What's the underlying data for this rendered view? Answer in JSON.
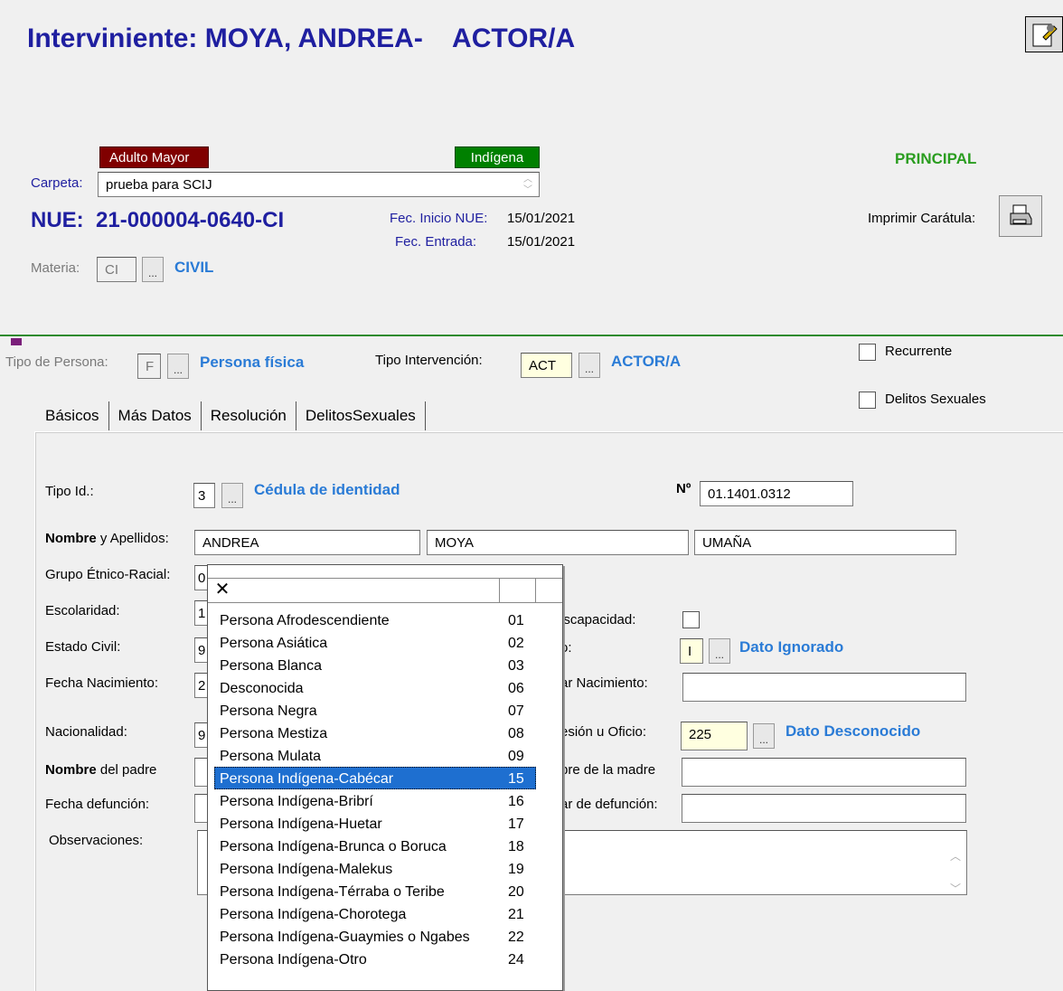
{
  "title": "Interviniente: MOYA, ANDREA-    ACTOR/A",
  "badges": {
    "adulto": "Adulto Mayor",
    "indigena": "Indígena"
  },
  "principal": "PRINCIPAL",
  "carpeta": {
    "label": "Carpeta:",
    "value": "prueba para SCIJ"
  },
  "nue": {
    "label": "NUE:",
    "value": "21-000004-0640-CI"
  },
  "fechas": {
    "inicio_label": "Fec. Inicio NUE:",
    "inicio": "15/01/2021",
    "entrada_label": "Fec. Entrada:",
    "entrada": "15/01/2021"
  },
  "imprimir": {
    "label": "Imprimir Carátula:"
  },
  "materia": {
    "label": "Materia:",
    "code": "CI",
    "desc": "CIVIL",
    "dots": "..."
  },
  "persona": {
    "label": "Tipo de Persona:",
    "code": "F",
    "desc": "Persona física"
  },
  "intervencion": {
    "label": "Tipo Intervención:",
    "code": "ACT",
    "desc": "ACTOR/A"
  },
  "checks": {
    "recurrente": "Recurrente",
    "delitos": "Delitos Sexuales"
  },
  "tabs": [
    "Básicos",
    "Más Datos",
    "Resolución",
    "DelitosSexuales"
  ],
  "form": {
    "tipo_id_label": "Tipo Id.:",
    "tipo_id_code": "3",
    "tipo_id_desc": "Cédula de identidad",
    "num_label": "Nº",
    "num_value": "01.1401.0312",
    "nombre_label_b": "Nombre",
    "nombre_label_r": " y Apellidos:",
    "nombre": "ANDREA",
    "apellido1": "MOYA",
    "apellido2": "UMAÑA",
    "grupo_label": "Grupo Étnico-Racial:",
    "grupo_code": "0",
    "escolaridad_label": "Escolaridad:",
    "escolaridad_code": "1",
    "discapacidad_label": "iscapacidad:",
    "estado_label": "Estado Civil:",
    "estado_code": "9",
    "sexo_label": "o:",
    "sexo_code": "I",
    "sexo_desc": "Dato Ignorado",
    "fecha_nac_label": "Fecha Nacimiento:",
    "fecha_nac_code": "2",
    "lugar_nac_label": "ar Nacimiento:",
    "nacionalidad_label": "Nacionalidad:",
    "nacionalidad_code": "9",
    "profesion_label": "esión u Oficio:",
    "profesion_code": "225",
    "profesion_desc": "Dato Desconocido",
    "padre_label_b": "Nombre",
    "padre_label_r": " del padre",
    "madre_label": "bre de la madre",
    "defuncion_label": "Fecha defunción:",
    "lugar_def_label": "ar de defunción:",
    "obs_label": "Observaciones:"
  },
  "dropdown": {
    "close": "✕",
    "items": [
      {
        "name": "Persona Afrodescendiente",
        "code": "01"
      },
      {
        "name": "Persona Asiática",
        "code": "02"
      },
      {
        "name": "Persona Blanca",
        "code": "03"
      },
      {
        "name": "Desconocida",
        "code": "06"
      },
      {
        "name": "Persona Negra",
        "code": "07"
      },
      {
        "name": "Persona Mestiza",
        "code": "08"
      },
      {
        "name": "Persona Mulata",
        "code": "09"
      },
      {
        "name": "Persona Indígena-Cabécar",
        "code": "15"
      },
      {
        "name": "Persona Indígena-Bribrí",
        "code": "16"
      },
      {
        "name": "Persona Indígena-Huetar",
        "code": "17"
      },
      {
        "name": "Persona Indígena-Brunca o Boruca",
        "code": "18"
      },
      {
        "name": "Persona Indígena-Malekus",
        "code": "19"
      },
      {
        "name": "Persona Indígena-Térraba o Teribe",
        "code": "20"
      },
      {
        "name": "Persona Indígena-Chorotega",
        "code": "21"
      },
      {
        "name": "Persona Indígena-Guaymies o Ngabes",
        "code": "22"
      },
      {
        "name": "Persona Indígena-Otro",
        "code": "24"
      }
    ],
    "selected_index": 7
  },
  "icons": [
    "edit-icon",
    "printer-icon",
    "close-icon",
    "scroll-up-icon",
    "scroll-down-icon"
  ]
}
